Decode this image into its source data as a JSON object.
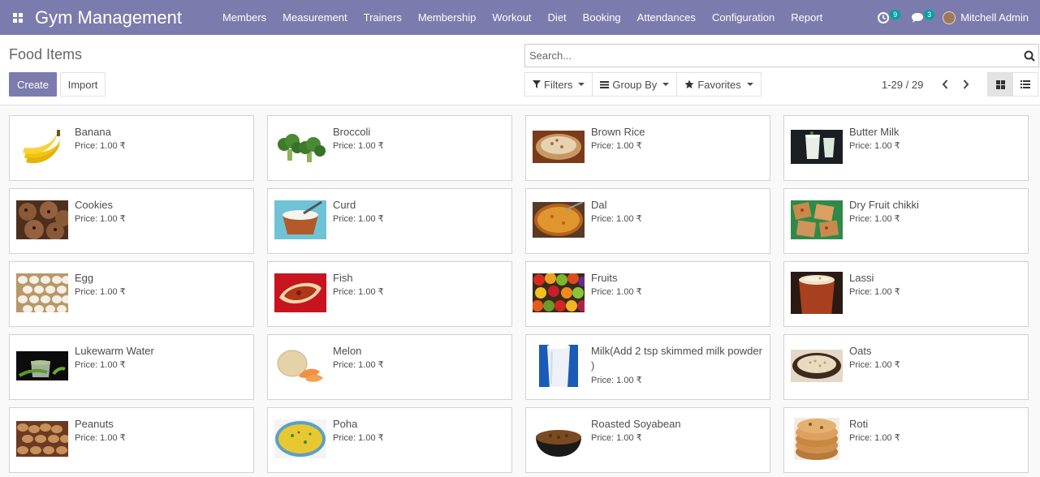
{
  "app": {
    "brand": "Gym Management"
  },
  "menu": [
    "Members",
    "Measurement",
    "Trainers",
    "Membership",
    "Workout",
    "Diet",
    "Booking",
    "Attendances",
    "Configuration",
    "Report"
  ],
  "systray": {
    "activity_count": "9",
    "message_count": "3",
    "user_name": "Mitchell Admin"
  },
  "control": {
    "title": "Food Items",
    "create_label": "Create",
    "import_label": "Import",
    "search_placeholder": "Search...",
    "filters_label": "Filters",
    "group_by_label": "Group By",
    "favorites_label": "Favorites",
    "pager": "1-29 / 29"
  },
  "colors": {
    "navbar": "#7c7bad",
    "primary": "#7c7bad",
    "badge": "#00a09d"
  },
  "price_label": "Price: 1.00 ₹",
  "items": [
    {
      "name": "Banana",
      "price": "Price: 1.00 ₹",
      "icon": "banana-image"
    },
    {
      "name": "Broccoli",
      "price": "Price: 1.00 ₹",
      "icon": "broccoli-image"
    },
    {
      "name": "Brown Rice",
      "price": "Price: 1.00 ₹",
      "icon": "brown-rice-image"
    },
    {
      "name": "Butter Milk",
      "price": "Price: 1.00 ₹",
      "icon": "butter-milk-image"
    },
    {
      "name": "Cookies",
      "price": "Price: 1.00 ₹",
      "icon": "cookies-image"
    },
    {
      "name": "Curd",
      "price": "Price: 1.00 ₹",
      "icon": "curd-image"
    },
    {
      "name": "Dal",
      "price": "Price: 1.00 ₹",
      "icon": "dal-image"
    },
    {
      "name": "Dry Fruit chikki",
      "price": "Price: 1.00 ₹",
      "icon": "chikki-image"
    },
    {
      "name": "Egg",
      "price": "Price: 1.00 ₹",
      "icon": "egg-image"
    },
    {
      "name": "Fish",
      "price": "Price: 1.00 ₹",
      "icon": "fish-image"
    },
    {
      "name": "Fruits",
      "price": "Price: 1.00 ₹",
      "icon": "fruits-image"
    },
    {
      "name": "Lassi",
      "price": "Price: 1.00 ₹",
      "icon": "lassi-image"
    },
    {
      "name": "Lukewarm Water",
      "price": "Price: 1.00 ₹",
      "icon": "water-image"
    },
    {
      "name": "Melon",
      "price": "Price: 1.00 ₹",
      "icon": "melon-image"
    },
    {
      "name": "Milk(Add 2 tsp skimmed milk powder )",
      "price": "Price: 1.00 ₹",
      "icon": "milk-image"
    },
    {
      "name": "Oats",
      "price": "Price: 1.00 ₹",
      "icon": "oats-image"
    },
    {
      "name": "Peanuts",
      "price": "Price: 1.00 ₹",
      "icon": "peanuts-image"
    },
    {
      "name": "Poha",
      "price": "Price: 1.00 ₹",
      "icon": "poha-image"
    },
    {
      "name": "Roasted Soyabean",
      "price": "Price: 1.00 ₹",
      "icon": "soyabean-image"
    },
    {
      "name": "Roti",
      "price": "Price: 1.00 ₹",
      "icon": "roti-image"
    }
  ]
}
